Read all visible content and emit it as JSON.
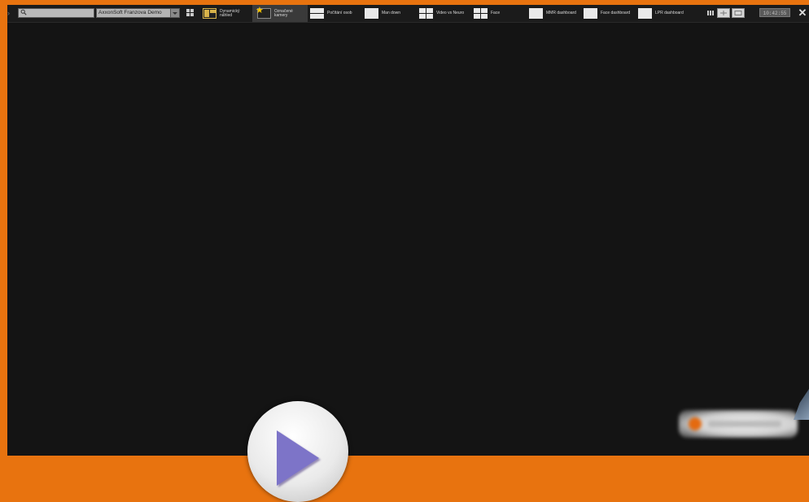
{
  "toolbar": {
    "server_name": "AxxonSoft Franzova Demo",
    "layouts": [
      {
        "label_line1": "Dynamický",
        "label_line2": "náhled",
        "thumb": "dynamic"
      },
      {
        "label_line1": "Označené",
        "label_line2": "kamery",
        "thumb": "favorite",
        "active": true
      },
      {
        "label_line1": "Počítání osob",
        "label_line2": "",
        "thumb": "split2"
      },
      {
        "label_line1": "Man down",
        "label_line2": "",
        "thumb": "single"
      },
      {
        "label_line1": "Video vs Neuro",
        "label_line2": "",
        "thumb": "split4"
      },
      {
        "label_line1": "Face",
        "label_line2": "",
        "thumb": "split4"
      },
      {
        "label_line1": "MMR dashboard",
        "label_line2": "",
        "thumb": "single"
      },
      {
        "label_line1": "Face dashboard",
        "label_line2": "",
        "thumb": "single"
      },
      {
        "label_line1": "LPR dashboard",
        "label_line2": "",
        "thumb": "single"
      }
    ],
    "clock": "10:42:55"
  },
  "colors": {
    "frame_accent": "#e8730f",
    "background": "#141414",
    "toolbar": "#1b1b1b",
    "play_triangle": "#7d74c8"
  },
  "icons": {
    "search": "search-icon",
    "close": "close-icon",
    "play": "play-icon",
    "star": "star-icon"
  }
}
